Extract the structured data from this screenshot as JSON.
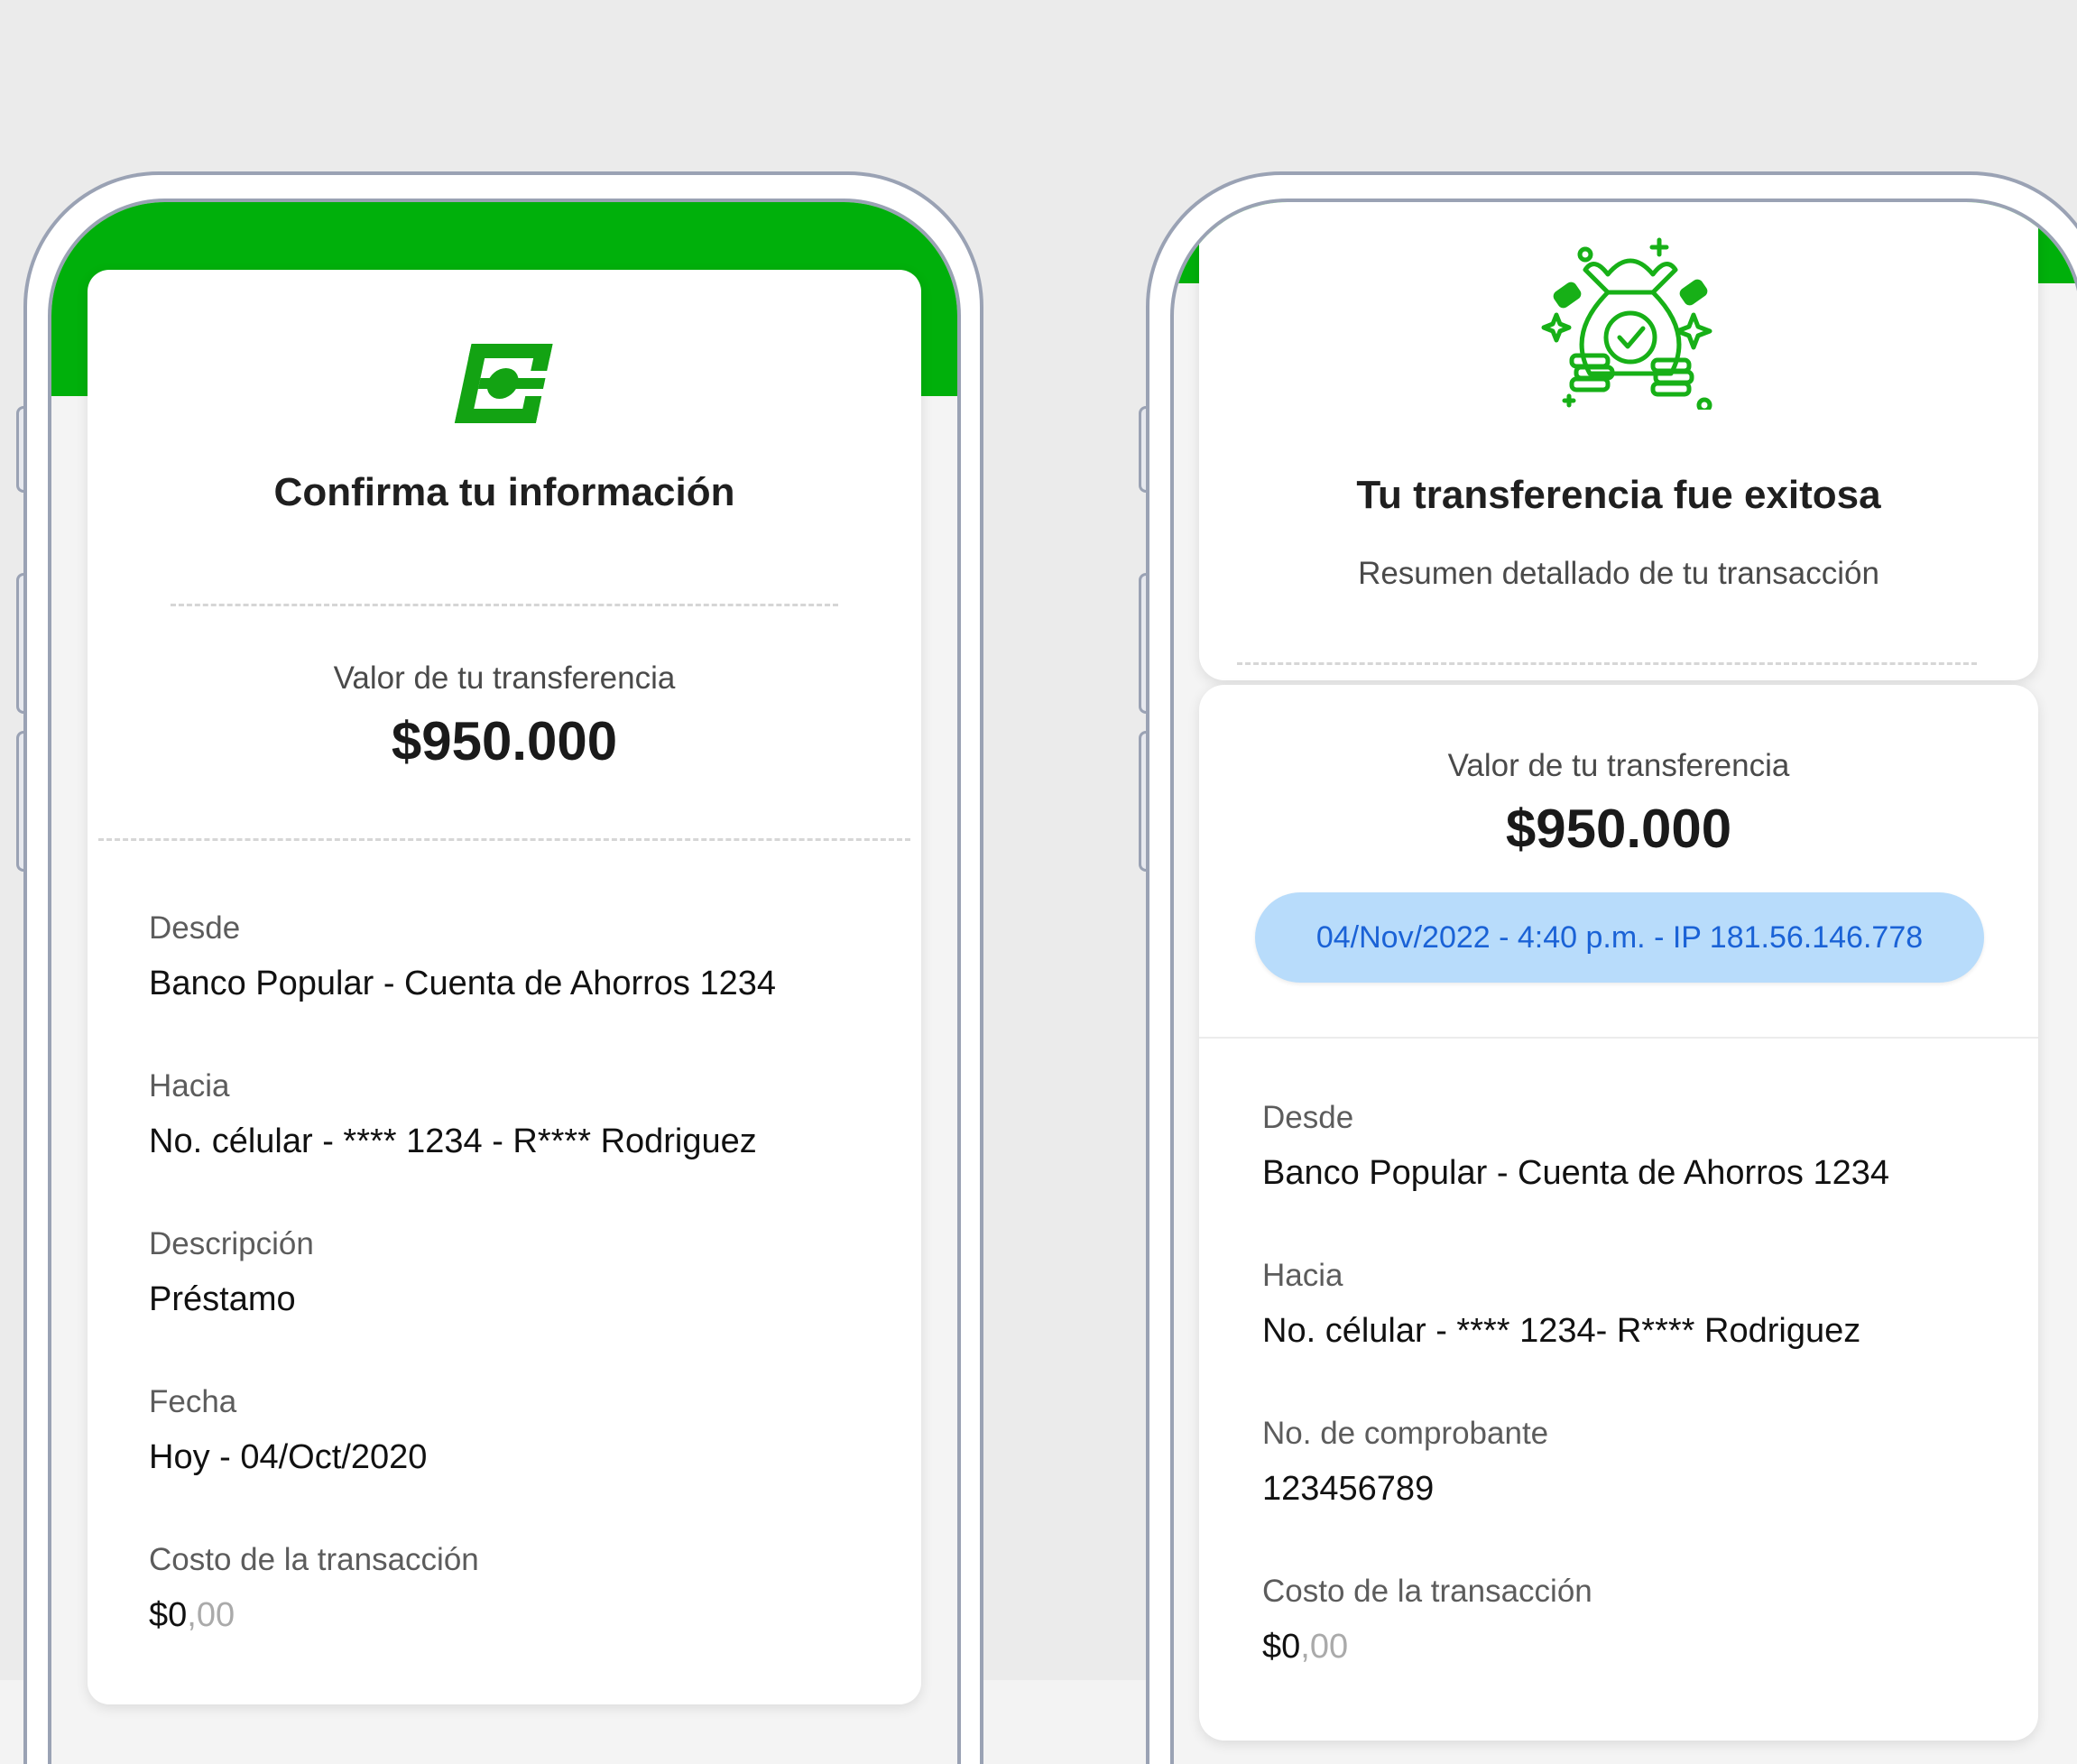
{
  "colors": {
    "brand_green": "#00b00b",
    "frame_gray": "#9aa2b4",
    "pill_blue_bg": "#b8dcfb",
    "pill_blue_text": "#1a62d6"
  },
  "confirm_screen": {
    "logo_icon": "bank-logo-icon",
    "title": "Confirma tu información",
    "amount_label": "Valor de tu transferencia",
    "amount": "$950.000",
    "fields": [
      {
        "label": "Desde",
        "value": "Banco Popular - Cuenta de Ahorros 1234"
      },
      {
        "label": "Hacia",
        "value": "No. célular - **** 1234 - R**** Rodriguez"
      },
      {
        "label": "Descripción",
        "value": "Préstamo"
      },
      {
        "label": "Fecha",
        "value": "Hoy - 04/Oct/2020"
      }
    ],
    "cost": {
      "label": "Costo de la transacción",
      "main": "$0",
      "decimals": ",00"
    }
  },
  "success_screen": {
    "illustration_icon": "money-bag-check-icon",
    "title": "Tu transferencia fue exitosa",
    "subtitle": "Resumen detallado de tu transacción",
    "amount_label": "Valor de tu transferencia",
    "amount": "$950.000",
    "meta": "04/Nov/2022 - 4:40 p.m. - IP 181.56.146.778",
    "fields": [
      {
        "label": "Desde",
        "value": "Banco Popular - Cuenta de Ahorros 1234"
      },
      {
        "label": "Hacia",
        "value": "No. célular - **** 1234- R**** Rodriguez"
      },
      {
        "label": "No. de comprobante",
        "value": "123456789"
      }
    ],
    "cost": {
      "label": "Costo de la transacción",
      "main": "$0",
      "decimals": ",00"
    }
  }
}
